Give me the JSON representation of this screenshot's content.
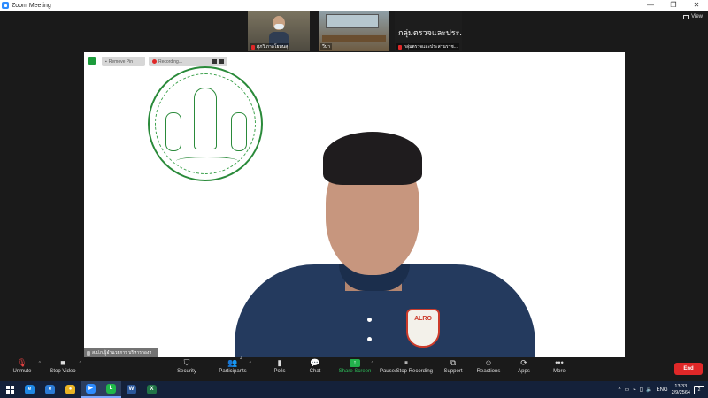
{
  "window": {
    "title": "Zoom Meeting",
    "controls": [
      "—",
      "❐",
      "✕"
    ]
  },
  "view_button": {
    "label": "View"
  },
  "thumbnails": [
    {
      "name": "ศุภวิ  ภาลโยทนสุ"
    },
    {
      "name": "วีนา"
    },
    {
      "big_text": "กลุ่มตรวจและประ...",
      "name": "กลุ่มตรวจและประสานราช..."
    }
  ],
  "main_video": {
    "remove_pin_label": "Remove Pin",
    "recording_label": "Recording...",
    "shirt_logo_text": "ALRO",
    "name_tag": "ส.ป.ก.ผู้อำนวยการ บริหารกองฯ"
  },
  "toolbar": {
    "unmute": "Unmute",
    "stop_video": "Stop Video",
    "security": "Security",
    "participants": "Participants",
    "participants_count": "4",
    "polls": "Polls",
    "chat": "Chat",
    "share_screen": "Share Screen",
    "pause_stop_recording": "Pause/Stop Recording",
    "support": "Support",
    "reactions": "Reactions",
    "apps": "Apps",
    "more": "More",
    "end": "End"
  },
  "taskbar": {
    "apps": [
      {
        "name": "edge",
        "color": "#1e88e5",
        "glyph": "e"
      },
      {
        "name": "ie",
        "color": "#2b7bd6",
        "glyph": "e"
      },
      {
        "name": "chrome",
        "color": "#e8b324",
        "glyph": "●"
      },
      {
        "name": "zoom",
        "color": "#2d8cff",
        "glyph": "▶"
      },
      {
        "name": "line",
        "color": "#20b84a",
        "glyph": "L"
      },
      {
        "name": "word",
        "color": "#2b579a",
        "glyph": "W"
      },
      {
        "name": "excel",
        "color": "#217346",
        "glyph": "X"
      }
    ],
    "language": "ENG",
    "time": "13:33",
    "date": "2/9/2564",
    "notifications": "2"
  },
  "colors": {
    "accent": "#2d8cff",
    "end_button": "#e02828",
    "share_green": "#2dbd5a"
  }
}
